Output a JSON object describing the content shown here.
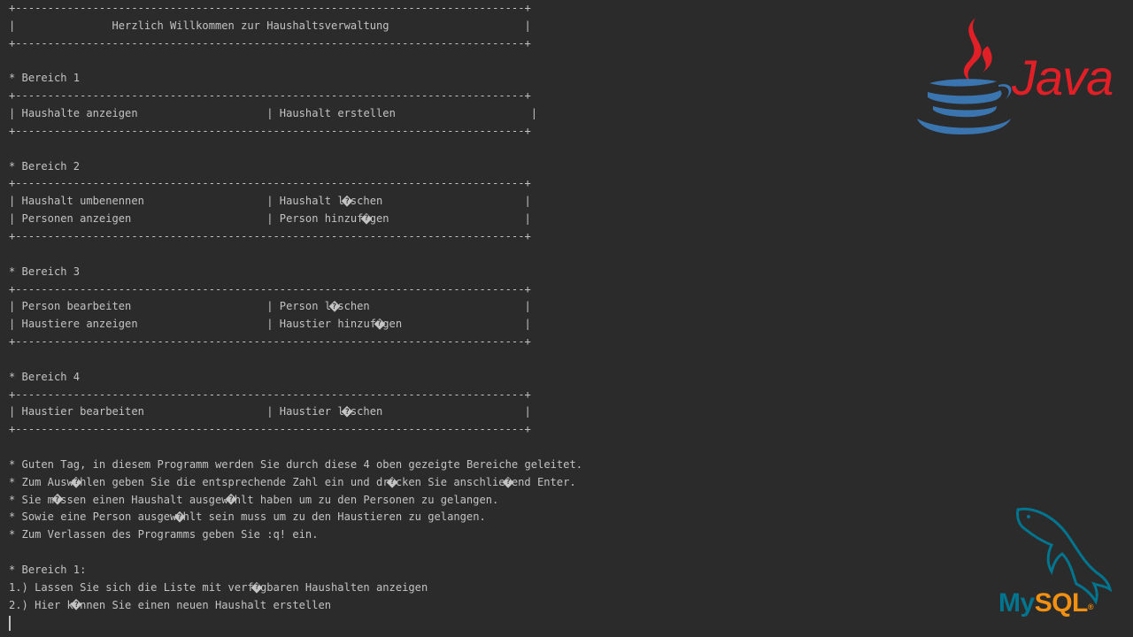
{
  "console": {
    "lines": [
      "+-------------------------------------------------------------------------------+",
      "|               Herzlich Willkommen zur Haushaltsverwaltung                     |",
      "+-------------------------------------------------------------------------------+",
      "",
      "* Bereich 1",
      "+-------------------------------------------------------------------------------+",
      "| Haushalte anzeigen                    | Haushalt erstellen                     |",
      "+-------------------------------------------------------------------------------+",
      "",
      "* Bereich 2",
      "+-------------------------------------------------------------------------------+",
      "| Haushalt umbenennen                   | Haushalt l�schen                      |",
      "| Personen anzeigen                     | Person hinzuf�gen                     |",
      "+-------------------------------------------------------------------------------+",
      "",
      "* Bereich 3",
      "+-------------------------------------------------------------------------------+",
      "| Person bearbeiten                     | Person l�schen                        |",
      "| Haustiere anzeigen                    | Haustier hinzuf�gen                   |",
      "+-------------------------------------------------------------------------------+",
      "",
      "* Bereich 4",
      "+-------------------------------------------------------------------------------+",
      "| Haustier bearbeiten                   | Haustier l�schen                      |",
      "+-------------------------------------------------------------------------------+",
      "",
      "* Guten Tag, in diesem Programm werden Sie durch diese 4 oben gezeigte Bereiche geleitet.",
      "* Zum Ausw�hlen geben Sie die entsprechende Zahl ein und dr�cken Sie anschlie�end Enter.",
      "* Sie m�ssen einen Haushalt ausgew�hlt haben um zu den Personen zu gelangen.",
      "* Sowie eine Person ausgew�hlt sein muss um zu den Haustieren zu gelangen.",
      "* Zum Verlassen des Programms geben Sie :q! ein.",
      "",
      "* Bereich 1:",
      "1.) Lassen Sie sich die Liste mit verf�gbaren Haushalten anzeigen",
      "2.) Hier k�nnen Sie einen neuen Haushalt erstellen"
    ]
  },
  "logos": {
    "java": {
      "word": "Java",
      "icon": "java-coffee-cup-icon",
      "color_red": "#e11f26",
      "color_blue": "#3a75b0"
    },
    "mysql": {
      "word_my": "My",
      "word_sql": "SQL",
      "registered": "®",
      "icon": "mysql-dolphin-icon",
      "color_blue": "#00758f",
      "color_orange": "#f29111"
    }
  },
  "colors": {
    "background": "#2b2b2b",
    "text": "#c3c3c3"
  }
}
